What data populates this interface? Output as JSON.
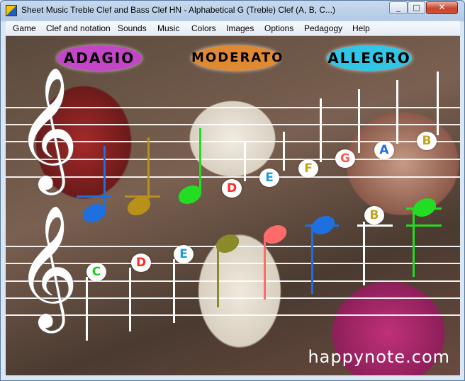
{
  "window": {
    "title": "Sheet Music Treble Clef and Bass Clef HN - Alphabetical G (Treble) Clef (A, B, C...)",
    "minimize_glyph": "_",
    "maximize_glyph": "□",
    "close_glyph": "✕"
  },
  "menu": {
    "items": [
      {
        "label": "Game"
      },
      {
        "label": "Clef and notation"
      },
      {
        "label": "Sounds"
      },
      {
        "label": "Music"
      },
      {
        "label": "Colors"
      },
      {
        "label": "Images"
      },
      {
        "label": "Options"
      },
      {
        "label": "Pedagogy"
      },
      {
        "label": "Help"
      }
    ]
  },
  "tempo": {
    "adagio": "ADAGIO",
    "moderato": "MODERATO",
    "allegro": "ALLEGRO"
  },
  "clefs": {
    "treble_glyph": "𝄞"
  },
  "notes": {
    "upper_staff": [
      {
        "color": "#1e6fe0",
        "label": "",
        "stem": "up"
      },
      {
        "color": "#b8901a",
        "label": "",
        "stem": "up"
      },
      {
        "color": "#22dd22",
        "label": "",
        "stem": "up"
      },
      {
        "color": "#ff2a2a",
        "label": "D"
      },
      {
        "color": "#1e9be8",
        "label": "E"
      },
      {
        "color": "#c2a41e",
        "label": "F"
      },
      {
        "color": "#ff5a5a",
        "label": "G"
      },
      {
        "color": "#1e6fe0",
        "label": "A"
      },
      {
        "color": "#c2a41e",
        "label": "B"
      }
    ],
    "lower_staff": [
      {
        "color": "#22cc22",
        "label": "C"
      },
      {
        "color": "#ff2a2a",
        "label": "D"
      },
      {
        "color": "#1e9be8",
        "label": "E"
      },
      {
        "color": "#8a8a2a",
        "label": "",
        "stem": "up"
      },
      {
        "color": "#ff6a6a",
        "label": "",
        "stem": "up"
      },
      {
        "color": "#1e6fe0",
        "label": "",
        "stem": "down"
      },
      {
        "color": "#c2a41e",
        "label": "B"
      },
      {
        "color": "#22dd22",
        "label": "",
        "stem": "down"
      }
    ]
  },
  "watermark": "happynote.com"
}
